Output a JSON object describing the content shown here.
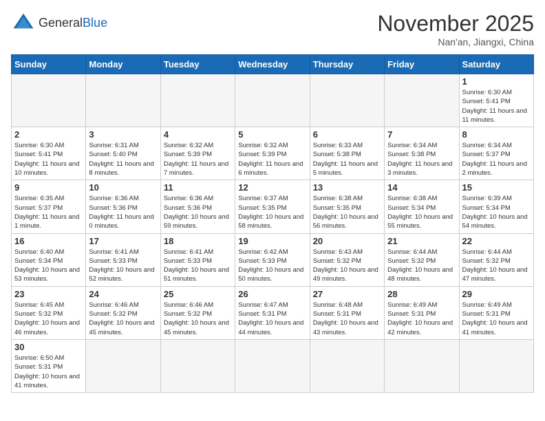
{
  "header": {
    "logo_general": "General",
    "logo_blue": "Blue",
    "month_title": "November 2025",
    "subtitle": "Nan'an, Jiangxi, China"
  },
  "days_of_week": [
    "Sunday",
    "Monday",
    "Tuesday",
    "Wednesday",
    "Thursday",
    "Friday",
    "Saturday"
  ],
  "weeks": [
    [
      {
        "day": "",
        "info": ""
      },
      {
        "day": "",
        "info": ""
      },
      {
        "day": "",
        "info": ""
      },
      {
        "day": "",
        "info": ""
      },
      {
        "day": "",
        "info": ""
      },
      {
        "day": "",
        "info": ""
      },
      {
        "day": "1",
        "info": "Sunrise: 6:30 AM\nSunset: 5:41 PM\nDaylight: 11 hours and 11 minutes."
      }
    ],
    [
      {
        "day": "2",
        "info": "Sunrise: 6:30 AM\nSunset: 5:41 PM\nDaylight: 11 hours and 10 minutes."
      },
      {
        "day": "3",
        "info": "Sunrise: 6:31 AM\nSunset: 5:40 PM\nDaylight: 11 hours and 8 minutes."
      },
      {
        "day": "4",
        "info": "Sunrise: 6:32 AM\nSunset: 5:39 PM\nDaylight: 11 hours and 7 minutes."
      },
      {
        "day": "5",
        "info": "Sunrise: 6:32 AM\nSunset: 5:39 PM\nDaylight: 11 hours and 6 minutes."
      },
      {
        "day": "6",
        "info": "Sunrise: 6:33 AM\nSunset: 5:38 PM\nDaylight: 11 hours and 5 minutes."
      },
      {
        "day": "7",
        "info": "Sunrise: 6:34 AM\nSunset: 5:38 PM\nDaylight: 11 hours and 3 minutes."
      },
      {
        "day": "8",
        "info": "Sunrise: 6:34 AM\nSunset: 5:37 PM\nDaylight: 11 hours and 2 minutes."
      }
    ],
    [
      {
        "day": "9",
        "info": "Sunrise: 6:35 AM\nSunset: 5:37 PM\nDaylight: 11 hours and 1 minute."
      },
      {
        "day": "10",
        "info": "Sunrise: 6:36 AM\nSunset: 5:36 PM\nDaylight: 11 hours and 0 minutes."
      },
      {
        "day": "11",
        "info": "Sunrise: 6:36 AM\nSunset: 5:36 PM\nDaylight: 10 hours and 59 minutes."
      },
      {
        "day": "12",
        "info": "Sunrise: 6:37 AM\nSunset: 5:35 PM\nDaylight: 10 hours and 58 minutes."
      },
      {
        "day": "13",
        "info": "Sunrise: 6:38 AM\nSunset: 5:35 PM\nDaylight: 10 hours and 56 minutes."
      },
      {
        "day": "14",
        "info": "Sunrise: 6:38 AM\nSunset: 5:34 PM\nDaylight: 10 hours and 55 minutes."
      },
      {
        "day": "15",
        "info": "Sunrise: 6:39 AM\nSunset: 5:34 PM\nDaylight: 10 hours and 54 minutes."
      }
    ],
    [
      {
        "day": "16",
        "info": "Sunrise: 6:40 AM\nSunset: 5:34 PM\nDaylight: 10 hours and 53 minutes."
      },
      {
        "day": "17",
        "info": "Sunrise: 6:41 AM\nSunset: 5:33 PM\nDaylight: 10 hours and 52 minutes."
      },
      {
        "day": "18",
        "info": "Sunrise: 6:41 AM\nSunset: 5:33 PM\nDaylight: 10 hours and 51 minutes."
      },
      {
        "day": "19",
        "info": "Sunrise: 6:42 AM\nSunset: 5:33 PM\nDaylight: 10 hours and 50 minutes."
      },
      {
        "day": "20",
        "info": "Sunrise: 6:43 AM\nSunset: 5:32 PM\nDaylight: 10 hours and 49 minutes."
      },
      {
        "day": "21",
        "info": "Sunrise: 6:44 AM\nSunset: 5:32 PM\nDaylight: 10 hours and 48 minutes."
      },
      {
        "day": "22",
        "info": "Sunrise: 6:44 AM\nSunset: 5:32 PM\nDaylight: 10 hours and 47 minutes."
      }
    ],
    [
      {
        "day": "23",
        "info": "Sunrise: 6:45 AM\nSunset: 5:32 PM\nDaylight: 10 hours and 46 minutes."
      },
      {
        "day": "24",
        "info": "Sunrise: 6:46 AM\nSunset: 5:32 PM\nDaylight: 10 hours and 45 minutes."
      },
      {
        "day": "25",
        "info": "Sunrise: 6:46 AM\nSunset: 5:32 PM\nDaylight: 10 hours and 45 minutes."
      },
      {
        "day": "26",
        "info": "Sunrise: 6:47 AM\nSunset: 5:31 PM\nDaylight: 10 hours and 44 minutes."
      },
      {
        "day": "27",
        "info": "Sunrise: 6:48 AM\nSunset: 5:31 PM\nDaylight: 10 hours and 43 minutes."
      },
      {
        "day": "28",
        "info": "Sunrise: 6:49 AM\nSunset: 5:31 PM\nDaylight: 10 hours and 42 minutes."
      },
      {
        "day": "29",
        "info": "Sunrise: 6:49 AM\nSunset: 5:31 PM\nDaylight: 10 hours and 41 minutes."
      }
    ],
    [
      {
        "day": "30",
        "info": "Sunrise: 6:50 AM\nSunset: 5:31 PM\nDaylight: 10 hours and 41 minutes."
      },
      {
        "day": "",
        "info": ""
      },
      {
        "day": "",
        "info": ""
      },
      {
        "day": "",
        "info": ""
      },
      {
        "day": "",
        "info": ""
      },
      {
        "day": "",
        "info": ""
      },
      {
        "day": "",
        "info": ""
      }
    ]
  ]
}
